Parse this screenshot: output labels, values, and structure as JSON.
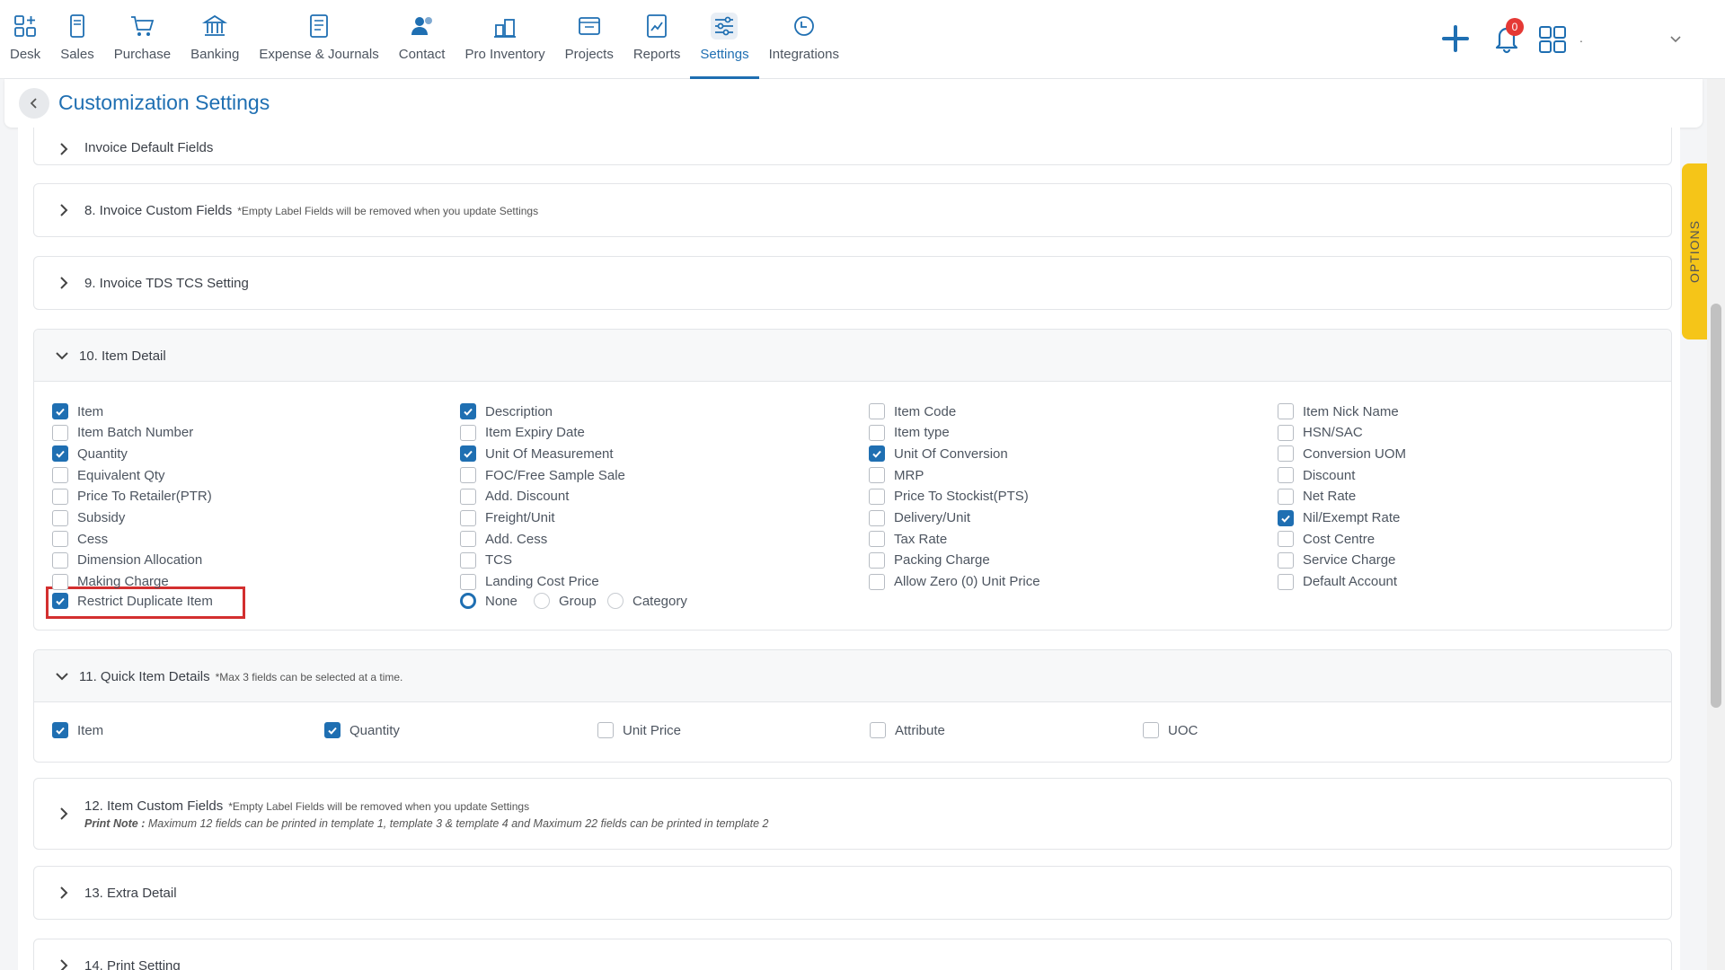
{
  "nav": {
    "items": [
      {
        "label": "Desk",
        "icon": "desk-icon"
      },
      {
        "label": "Sales",
        "icon": "sales-icon"
      },
      {
        "label": "Purchase",
        "icon": "cart-icon"
      },
      {
        "label": "Banking",
        "icon": "bank-icon"
      },
      {
        "label": "Expense & Journals",
        "icon": "journal-icon"
      },
      {
        "label": "Contact",
        "icon": "contact-icon"
      },
      {
        "label": "Pro Inventory",
        "icon": "inventory-icon"
      },
      {
        "label": "Projects",
        "icon": "projects-icon"
      },
      {
        "label": "Reports",
        "icon": "reports-icon"
      },
      {
        "label": "Settings",
        "icon": "settings-icon"
      },
      {
        "label": "Integrations",
        "icon": "integrations-icon"
      }
    ],
    "active": "Settings",
    "notification_count": "0",
    "user_name": "."
  },
  "header": {
    "title": "Customization Settings"
  },
  "options_tab": "OPTIONS",
  "sections": {
    "s7": {
      "title": "Invoice Default Fields"
    },
    "s8": {
      "title": "8. Invoice Custom Fields",
      "note": "*Empty Label Fields will be removed when you update Settings"
    },
    "s9": {
      "title": "9. Invoice TDS TCS Setting"
    },
    "s10": {
      "title": "10. Item Detail",
      "col1": [
        {
          "label": "Item",
          "checked": true
        },
        {
          "label": "Item Batch Number",
          "checked": false
        },
        {
          "label": "Quantity",
          "checked": true
        },
        {
          "label": "Equivalent Qty",
          "checked": false
        },
        {
          "label": "Price To Retailer(PTR)",
          "checked": false
        },
        {
          "label": "Subsidy",
          "checked": false
        },
        {
          "label": "Cess",
          "checked": false
        },
        {
          "label": "Dimension Allocation",
          "checked": false
        },
        {
          "label": "Making Charge",
          "checked": false
        },
        {
          "label": "Restrict Duplicate Item",
          "checked": true
        }
      ],
      "col2": [
        {
          "label": "Description",
          "checked": true
        },
        {
          "label": "Item Expiry Date",
          "checked": false
        },
        {
          "label": "Unit Of Measurement",
          "checked": true
        },
        {
          "label": "FOC/Free Sample Sale",
          "checked": false
        },
        {
          "label": "Add. Discount",
          "checked": false
        },
        {
          "label": "Freight/Unit",
          "checked": false
        },
        {
          "label": "Add. Cess",
          "checked": false
        },
        {
          "label": "TCS",
          "checked": false
        },
        {
          "label": "Landing Cost Price",
          "checked": false
        }
      ],
      "col3": [
        {
          "label": "Item Code",
          "checked": false
        },
        {
          "label": "Item type",
          "checked": false
        },
        {
          "label": "Unit Of Conversion",
          "checked": true
        },
        {
          "label": "MRP",
          "checked": false
        },
        {
          "label": "Price To Stockist(PTS)",
          "checked": false
        },
        {
          "label": "Delivery/Unit",
          "checked": false
        },
        {
          "label": "Tax Rate",
          "checked": false
        },
        {
          "label": "Packing Charge",
          "checked": false
        },
        {
          "label": "Allow Zero (0) Unit Price",
          "checked": false
        }
      ],
      "col4": [
        {
          "label": "Item Nick Name",
          "checked": false
        },
        {
          "label": "HSN/SAC",
          "checked": false
        },
        {
          "label": "Conversion UOM",
          "checked": false
        },
        {
          "label": "Discount",
          "checked": false
        },
        {
          "label": "Net Rate",
          "checked": false
        },
        {
          "label": "Nil/Exempt Rate",
          "checked": true
        },
        {
          "label": "Cost Centre",
          "checked": false
        },
        {
          "label": "Service Charge",
          "checked": false
        },
        {
          "label": "Default Account",
          "checked": false
        }
      ],
      "radios": [
        {
          "label": "None",
          "selected": true
        },
        {
          "label": "Group",
          "selected": false
        },
        {
          "label": "Category",
          "selected": false
        }
      ]
    },
    "s11": {
      "title": "11. Quick Item Details",
      "note": "*Max 3 fields can be selected at a time.",
      "items": [
        {
          "label": "Item",
          "checked": true
        },
        {
          "label": "Quantity",
          "checked": true
        },
        {
          "label": "Unit Price",
          "checked": false
        },
        {
          "label": "Attribute",
          "checked": false
        },
        {
          "label": "UOC",
          "checked": false
        }
      ]
    },
    "s12": {
      "title": "12. Item Custom Fields",
      "note": "*Empty Label Fields will be removed when you update Settings",
      "print_note_label": "Print Note :",
      "print_note": "Maximum 12 fields can be printed in template 1, template 3 & template 4 and Maximum 22 fields can be printed in template 2"
    },
    "s13": {
      "title": "13. Extra Detail"
    },
    "s14": {
      "title": "14. Print Setting"
    }
  },
  "colors": {
    "primary": "#1f6fb2",
    "highlight": "#d32f2f",
    "options": "#f5c518"
  }
}
